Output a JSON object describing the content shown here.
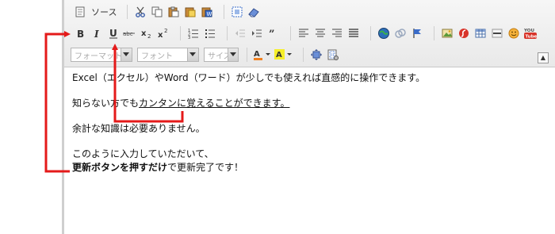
{
  "toolbar": {
    "source_label": "ソース",
    "format_placeholder": "フォーマット",
    "font_placeholder": "フォント",
    "size_placeholder": "サイズ",
    "collapse_symbol": "▲"
  },
  "content": {
    "line1": "Excel（エクセル）やWord（ワード）が少しでも使えれば直感的に操作できます。",
    "line2_prefix": "知らない方でも",
    "line2_underlined": "カンタンに覚えることができます。",
    "line3": "余計な知識は必要ありません。",
    "line4": "このように入力していただいて、",
    "line5_bold": "更新ボタンを押すだけ",
    "line5_rest": "で更新完了です！"
  },
  "colors": {
    "annotation": "#e41a1a",
    "toolbar_bg": "#eeeeee"
  },
  "icons": [
    "source-icon",
    "cut-icon",
    "copy-icon",
    "paste-icon",
    "paste-text-icon",
    "paste-word-icon",
    "select-all-icon",
    "remove-format-icon",
    "bold-icon",
    "italic-icon",
    "underline-icon",
    "strike-icon",
    "subscript-icon",
    "superscript-icon",
    "numbered-list-icon",
    "bulleted-list-icon",
    "outdent-icon",
    "indent-icon",
    "blockquote-icon",
    "align-left-icon",
    "align-center-icon",
    "align-right-icon",
    "align-justify-icon",
    "link-icon",
    "unlink-icon",
    "anchor-icon",
    "image-icon",
    "flash-icon",
    "table-icon",
    "horizontal-rule-icon",
    "smiley-icon",
    "youtube-icon",
    "text-color-icon",
    "bg-color-icon",
    "maximize-icon",
    "show-blocks-icon"
  ]
}
